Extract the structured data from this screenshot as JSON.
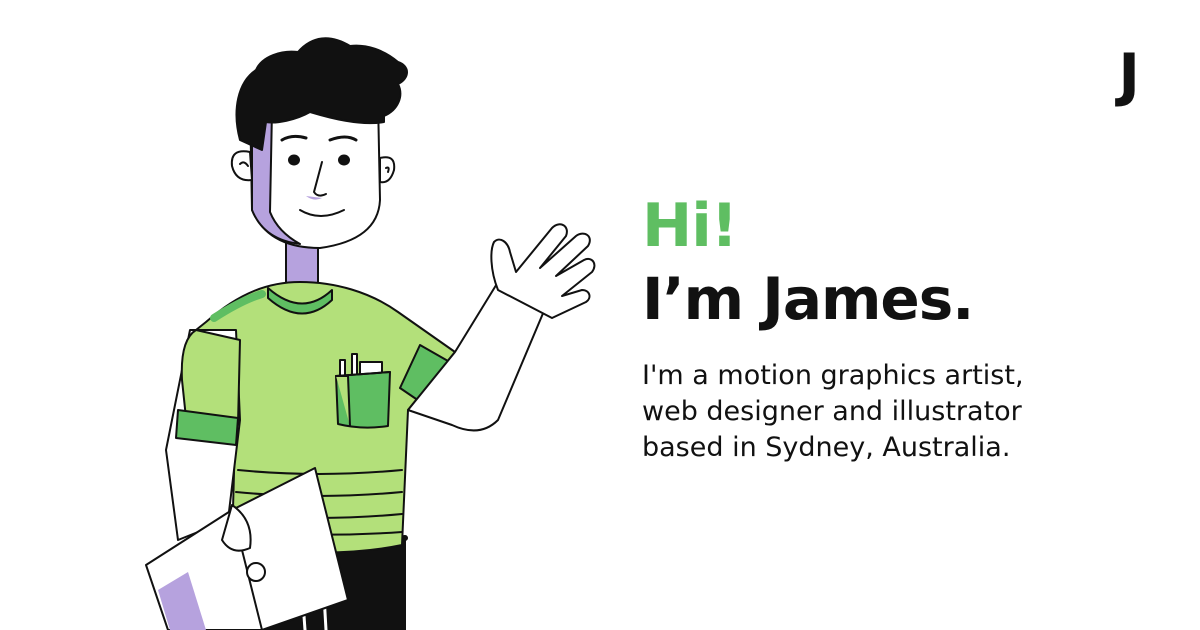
{
  "brand": {
    "logo_letter": "J"
  },
  "intro": {
    "greeting": "Hi!",
    "name": "I’m James.",
    "bio": "I'm a motion graphics artist, web designer and illustrator based in Sydney, Australia."
  },
  "colors": {
    "accent_green": "#5fbe62",
    "shirt_green": "#b3e07a",
    "shadow_purple": "#b6a2de",
    "ink": "#111111"
  },
  "icons": {
    "illustration": "waving-man-illustration"
  }
}
